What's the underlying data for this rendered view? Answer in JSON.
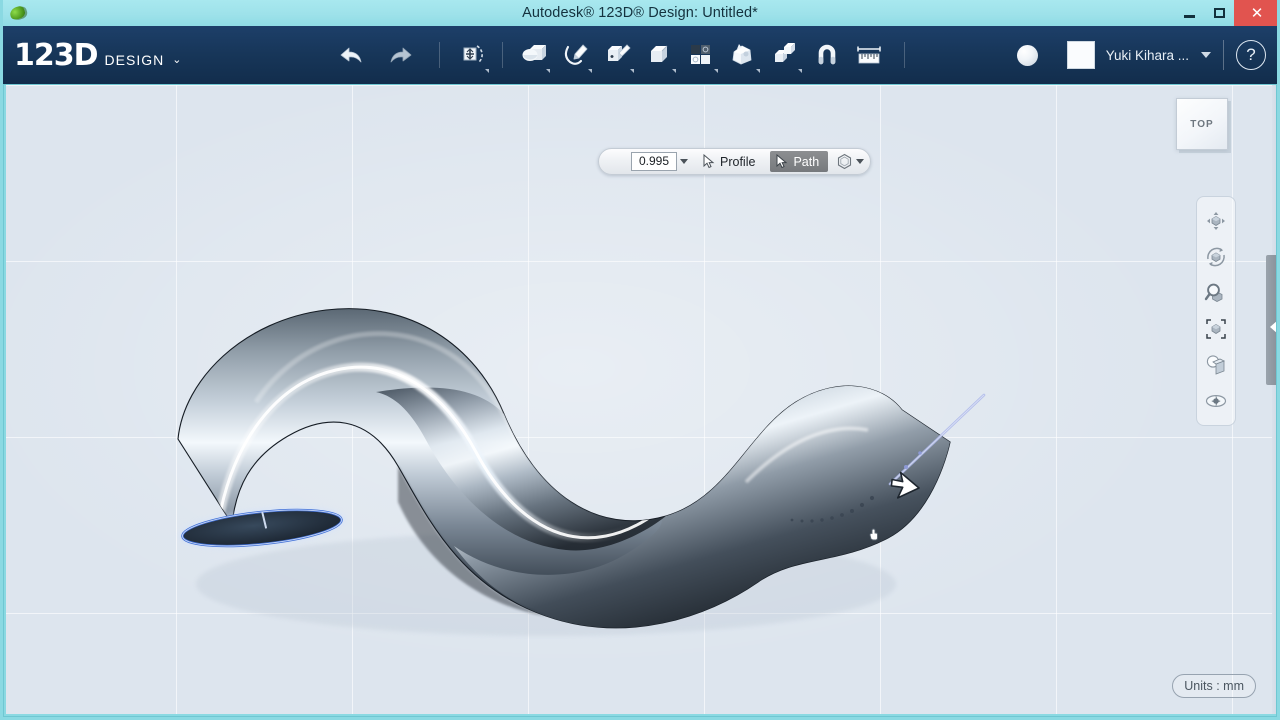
{
  "window": {
    "title": "Autodesk® 123D® Design: Untitled*",
    "app_icon": "app-logo-icon",
    "minimize_label": "—",
    "maximize_label": "□",
    "close_label": "✕"
  },
  "ribbon": {
    "brand_main": "123D",
    "brand_sub": "DESIGN",
    "brand_caret": "⌄",
    "undo_label": "Undo",
    "redo_label": "Redo",
    "tools": [
      {
        "name": "transform-tool",
        "label": "Transform",
        "has_caret": true
      },
      {
        "name": "primitives-tool",
        "label": "Primitives",
        "has_caret": true
      },
      {
        "name": "sketch-tool",
        "label": "Sketch",
        "has_caret": true
      },
      {
        "name": "construct-tool",
        "label": "Construct",
        "has_caret": true
      },
      {
        "name": "modify-tool",
        "label": "Modify",
        "has_caret": true
      },
      {
        "name": "pattern-tool",
        "label": "Pattern",
        "has_caret": true
      },
      {
        "name": "grouping-tool",
        "label": "Grouping",
        "has_caret": true
      },
      {
        "name": "combine-tool",
        "label": "Combine",
        "has_caret": true
      },
      {
        "name": "snap-tool",
        "label": "Snap",
        "has_caret": false
      },
      {
        "name": "measure-tool",
        "label": "Measure",
        "has_caret": false
      }
    ],
    "material_label": "Material",
    "account_name": "Yuki Kihara ...",
    "account_caret": "▾",
    "help_label": "?"
  },
  "context_toolbar": {
    "value": "0.995",
    "value_caret": "▾",
    "profile_label": "Profile",
    "path_label": "Path",
    "path_selected": true,
    "shape_caret": "▾"
  },
  "viewport": {
    "viewcube_label": "TOP",
    "units_label": "Units : mm",
    "background_color": "#dde5ee",
    "grid_color": "#ffffff",
    "path_line_color": "#a9b4e8",
    "model_edge_color": "#1b2430",
    "cap_fill_color": "#22303f",
    "cap_outline_color": "#3f6fd6"
  },
  "navbar": {
    "items": [
      {
        "name": "pan-icon",
        "label": "Pan"
      },
      {
        "name": "orbit-icon",
        "label": "Orbit"
      },
      {
        "name": "zoom-icon",
        "label": "Zoom"
      },
      {
        "name": "fit-icon",
        "label": "Fit"
      },
      {
        "name": "view-style-icon",
        "label": "View Style"
      },
      {
        "name": "visibility-eye-icon",
        "label": "Visibility"
      }
    ]
  },
  "right_panel": {
    "collapse_arrow": "◀"
  }
}
